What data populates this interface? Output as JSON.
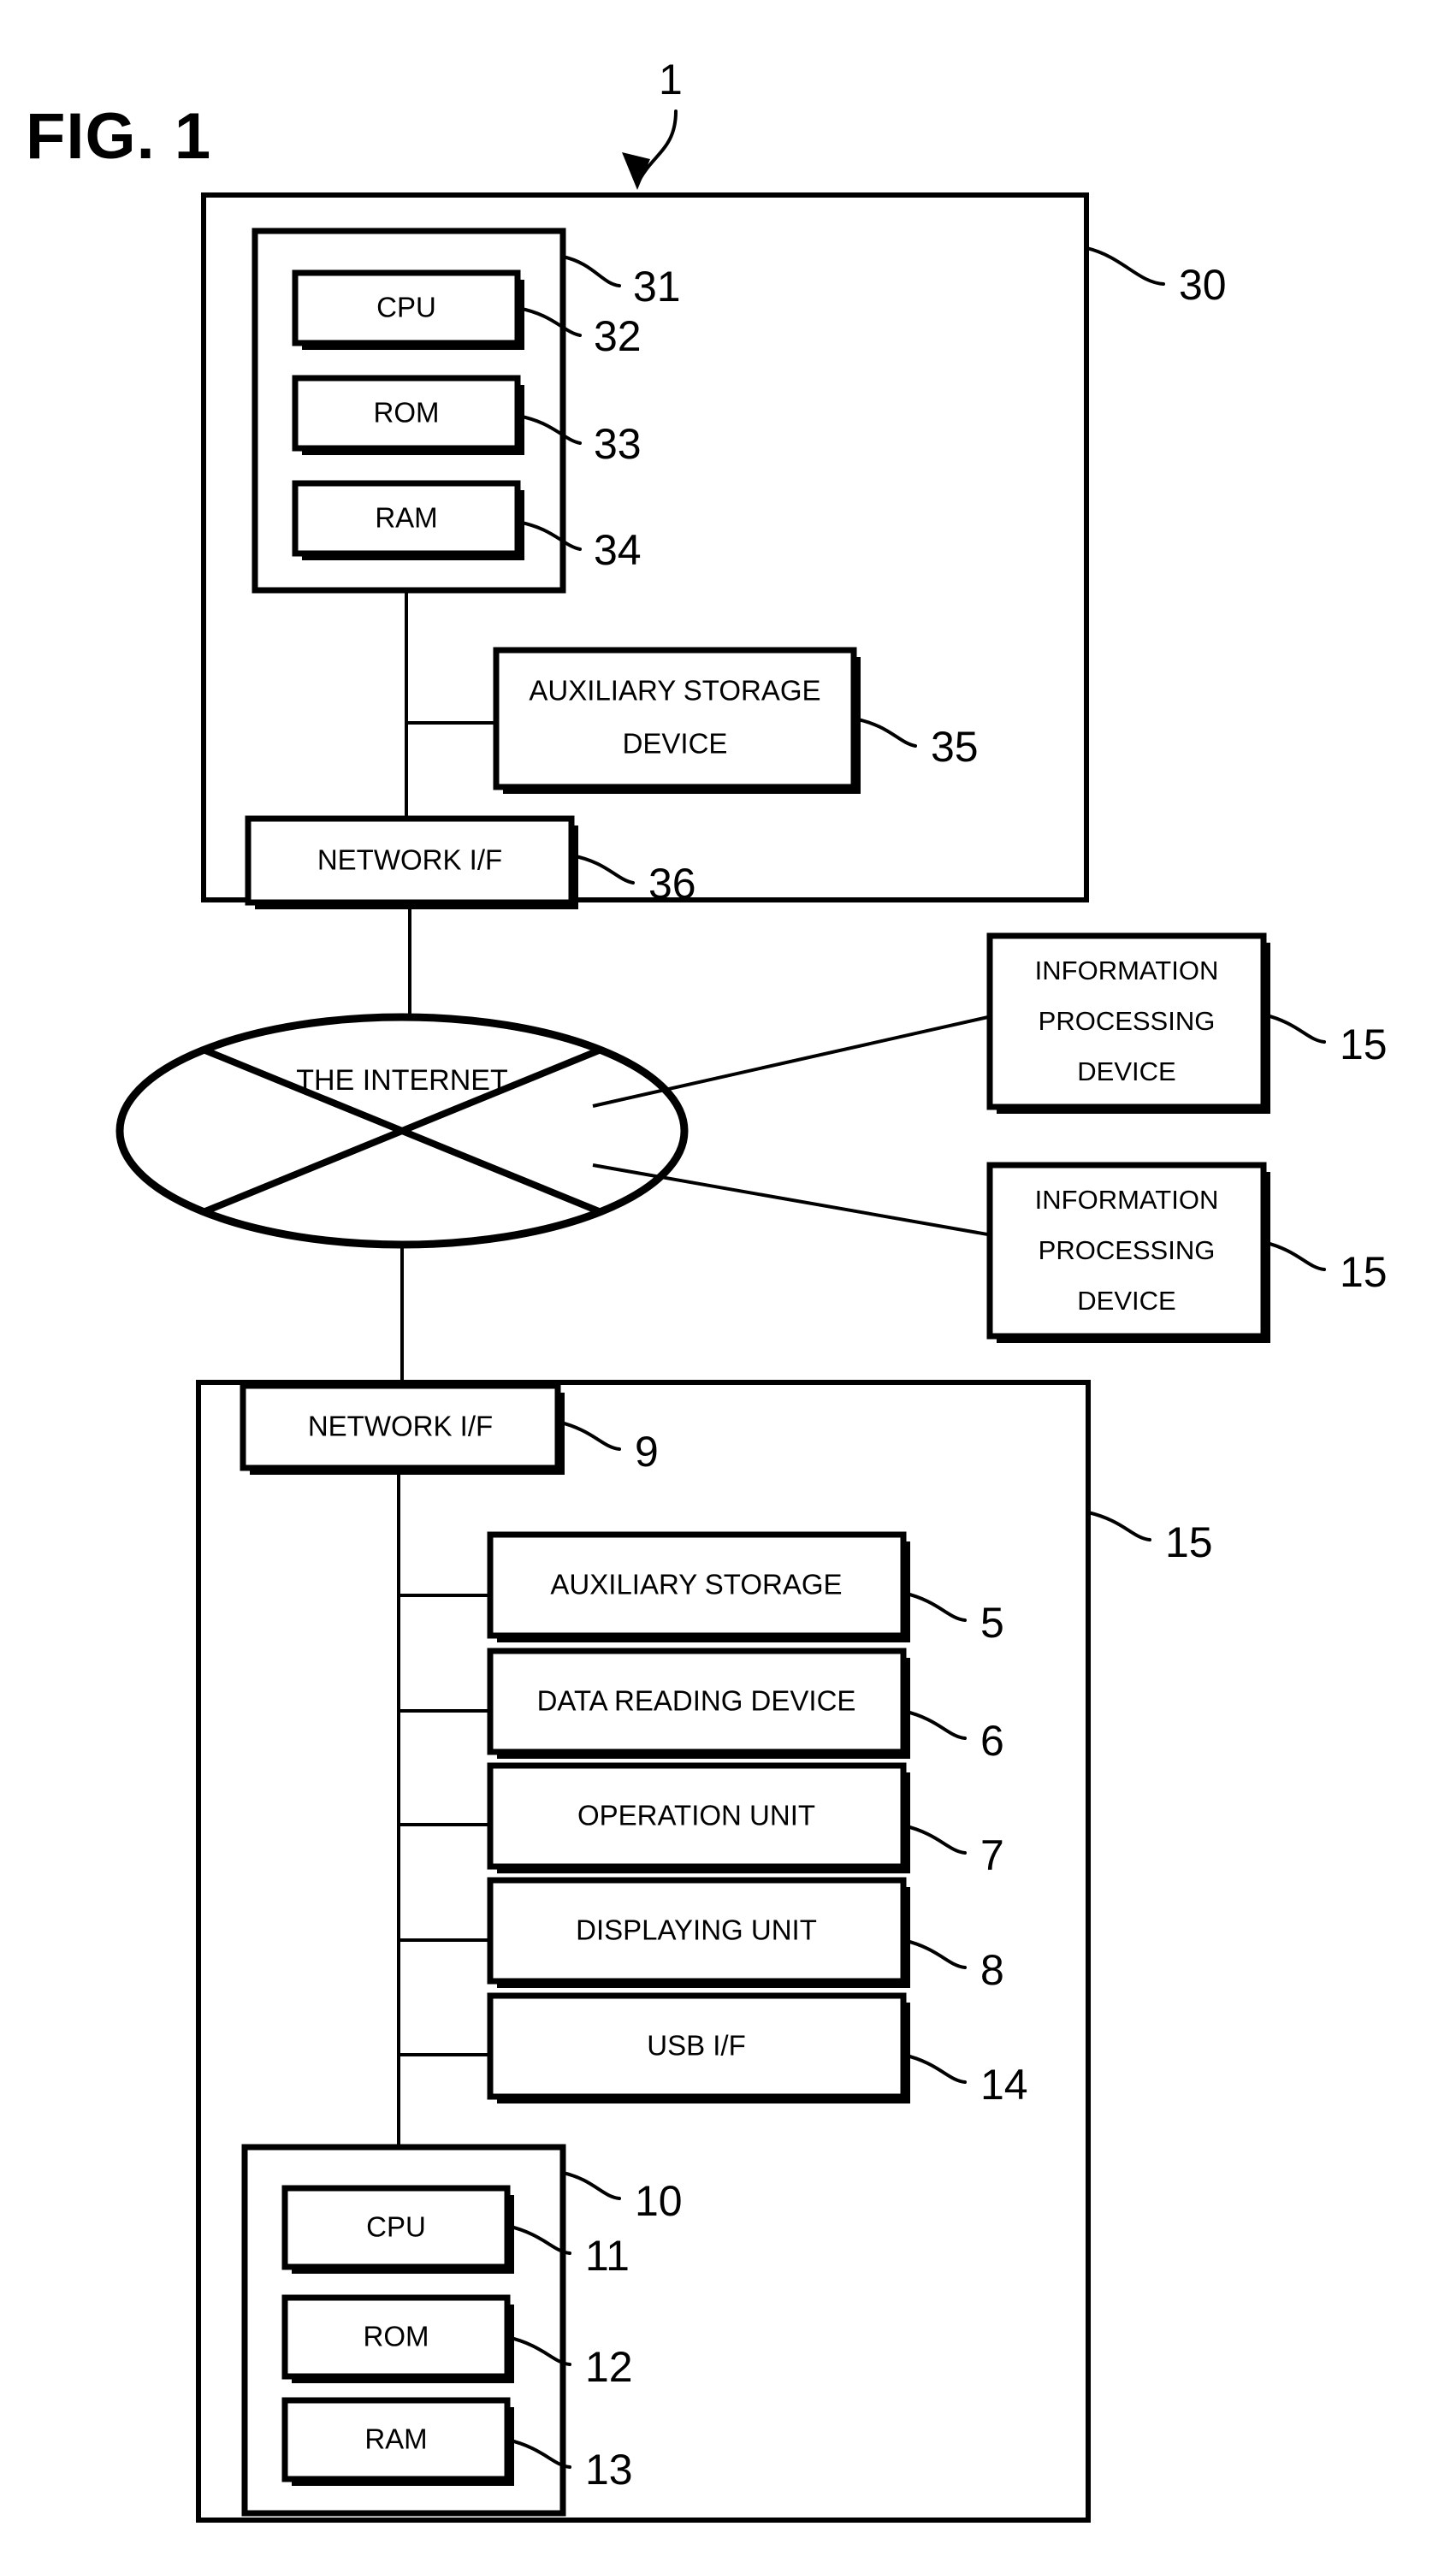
{
  "figure": {
    "title": "FIG. 1",
    "system_ref": "1"
  },
  "server": {
    "ref": "30",
    "control_unit": {
      "ref": "31",
      "modules": [
        {
          "label": "CPU",
          "ref": "32"
        },
        {
          "label": "ROM",
          "ref": "33"
        },
        {
          "label": "RAM",
          "ref": "34"
        }
      ]
    },
    "peripherals": [
      {
        "label_line1": "AUXILIARY STORAGE",
        "label_line2": "DEVICE",
        "ref": "35"
      }
    ],
    "network_if": {
      "label": "NETWORK I/F",
      "ref": "36"
    }
  },
  "network": {
    "label": "THE INTERNET"
  },
  "remote_devices": [
    {
      "label_line1": "INFORMATION",
      "label_line2": "PROCESSING",
      "label_line3": "DEVICE",
      "ref": "15"
    },
    {
      "label_line1": "INFORMATION",
      "label_line2": "PROCESSING",
      "label_line3": "DEVICE",
      "ref": "15"
    }
  ],
  "client": {
    "ref": "15",
    "network_if": {
      "label": "NETWORK I/F",
      "ref": "9"
    },
    "peripherals": [
      {
        "label": "AUXILIARY STORAGE",
        "ref": "5"
      },
      {
        "label": "DATA READING DEVICE",
        "ref": "6"
      },
      {
        "label": "OPERATION UNIT",
        "ref": "7"
      },
      {
        "label": "DISPLAYING UNIT",
        "ref": "8"
      },
      {
        "label": "USB I/F",
        "ref": "14"
      }
    ],
    "control_unit": {
      "ref": "10",
      "modules": [
        {
          "label": "CPU",
          "ref": "11"
        },
        {
          "label": "ROM",
          "ref": "12"
        },
        {
          "label": "RAM",
          "ref": "13"
        }
      ]
    }
  },
  "colors": {
    "ink": "#000000",
    "paper": "#ffffff"
  }
}
